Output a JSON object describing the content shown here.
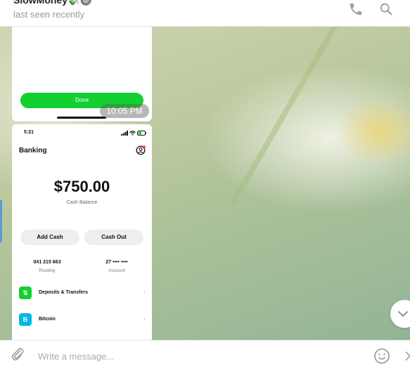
{
  "header": {
    "contact_name": "SlowMoney💸🔘",
    "status": "last seen recently",
    "icons": [
      "phone-icon",
      "search-icon"
    ]
  },
  "messages": {
    "first": {
      "done_label": "Done",
      "time": "10:05 PM"
    },
    "second": {
      "status_time": "5:21",
      "title": "Banking",
      "balance": "$750.00",
      "balance_label": "Cash Balance",
      "buttons": [
        "Add Cash",
        "Cash Out"
      ],
      "routing_number": "041 215 663",
      "routing_label": "Routing",
      "account_number": "27 •••• ••••",
      "account_label": "Account",
      "list": [
        {
          "label": "Deposits & Transfers",
          "icon": "transfer-icon",
          "color": "#12d02f",
          "glyph": "⇅"
        },
        {
          "label": "Bitcoin",
          "icon": "bitcoin-icon",
          "color": "#00b8e6",
          "glyph": "B"
        }
      ]
    }
  },
  "composer": {
    "placeholder": "Write a message..."
  },
  "colors": {
    "accent_green": "#12d02f",
    "bitcoin_blue": "#00b8e6",
    "left_edge_blue": "#5b9bd5"
  }
}
